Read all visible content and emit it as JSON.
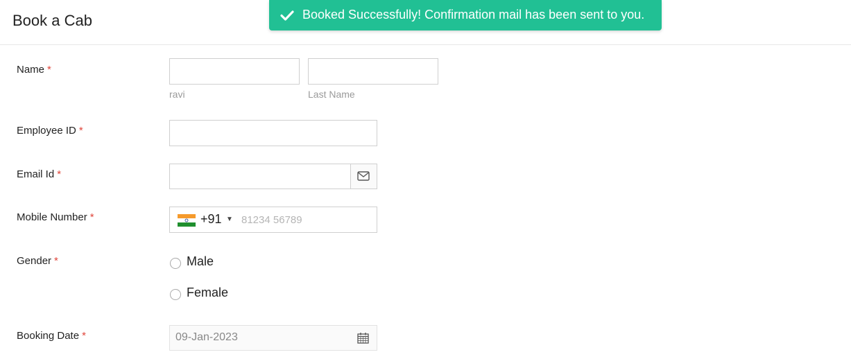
{
  "header": {
    "title": "Book a Cab"
  },
  "toast": {
    "message": "Booked Successfully! Confirmation mail has been sent to you.",
    "color": "#21c094"
  },
  "form": {
    "required_marker": "*",
    "name": {
      "label": "Name",
      "first_value": "",
      "first_sublabel": "ravi",
      "last_value": "",
      "last_sublabel": "Last Name"
    },
    "employee_id": {
      "label": "Employee ID",
      "value": ""
    },
    "email": {
      "label": "Email Id",
      "value": "",
      "icon": "mail-icon"
    },
    "mobile": {
      "label": "Mobile Number",
      "country_code": "+91",
      "flag": "india-flag",
      "placeholder": "81234 56789",
      "value": ""
    },
    "gender": {
      "label": "Gender",
      "options": [
        "Male",
        "Female"
      ]
    },
    "booking_date": {
      "label": "Booking Date",
      "value": "09-Jan-2023",
      "icon": "calendar-icon"
    }
  }
}
